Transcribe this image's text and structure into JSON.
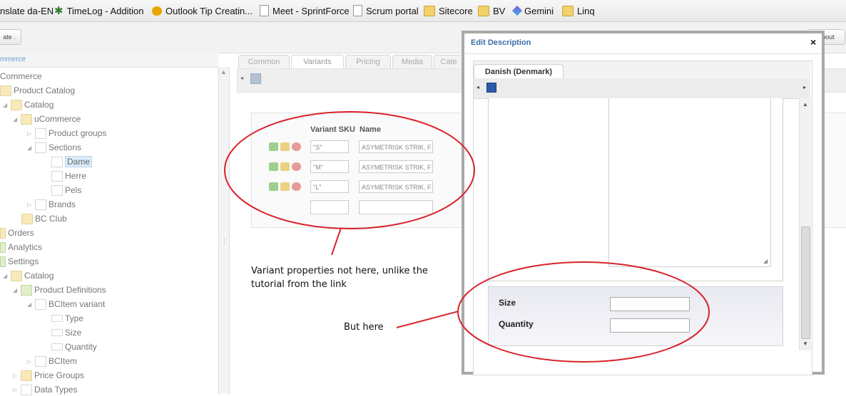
{
  "bookmarks": {
    "items": [
      {
        "label": "nslate da-EN",
        "icon": "none"
      },
      {
        "label": "TimeLog - Addition",
        "icon": "star-icon"
      },
      {
        "label": "Outlook Tip Creatin...",
        "icon": "outlook-icon"
      },
      {
        "label": "Meet - SprintForce",
        "icon": "page-icon"
      },
      {
        "label": "Scrum portal",
        "icon": "page-icon"
      },
      {
        "label": "Sitecore",
        "icon": "folder-icon"
      },
      {
        "label": "BV",
        "icon": "folder-icon"
      },
      {
        "label": "Gemini",
        "icon": "gemini-icon"
      },
      {
        "label": "Linq",
        "icon": "folder-icon"
      }
    ]
  },
  "toolbar": {
    "left_button": "ate .",
    "about_button": "About"
  },
  "tree": {
    "header": "mmerce",
    "nodes": [
      {
        "label": "Commerce"
      },
      {
        "label": "Product Catalog"
      },
      {
        "label": "Catalog"
      },
      {
        "label": "uCommerce"
      },
      {
        "label": "Product groups"
      },
      {
        "label": "Sections"
      },
      {
        "label": "Dame"
      },
      {
        "label": "Herre"
      },
      {
        "label": "Pels"
      },
      {
        "label": "Brands"
      },
      {
        "label": "BC Club"
      },
      {
        "label": "Orders"
      },
      {
        "label": "Analytics"
      },
      {
        "label": "Settings"
      },
      {
        "label": "Catalog"
      },
      {
        "label": "Product Definitions"
      },
      {
        "label": "BCItem variant"
      },
      {
        "label": "Type"
      },
      {
        "label": "Size"
      },
      {
        "label": "Quantity"
      },
      {
        "label": "BCItem"
      },
      {
        "label": "Price Groups"
      },
      {
        "label": "Data Types"
      }
    ]
  },
  "main": {
    "tabs": [
      {
        "label": "Common"
      },
      {
        "label": "Variants"
      },
      {
        "label": "Pricing"
      },
      {
        "label": "Media"
      },
      {
        "label": "Cate"
      }
    ],
    "variants": {
      "header_sku": "Variant SKU",
      "header_name": "Name",
      "rows": [
        {
          "sku": "\"S\"",
          "name": "ASYMETRISK STRIK, F"
        },
        {
          "sku": "\"M\"",
          "name": "ASYMETRISK STRIK, F"
        },
        {
          "sku": "\"L\"",
          "name": "ASYMETRISK STRIK, F"
        }
      ],
      "new_row": {
        "sku": "",
        "name": ""
      }
    }
  },
  "dialog": {
    "title": "Edit Description",
    "close": "×",
    "tab": "Danish (Denmark)",
    "fields": [
      {
        "label": "Size",
        "value": ""
      },
      {
        "label": "Quantity",
        "value": ""
      }
    ]
  },
  "annotations": {
    "note1_line1": "Variant properties not here, unlike the",
    "note1_line2": "tutorial from the link",
    "note2": "But here",
    "color": "#d9232a"
  },
  "colors": {
    "dialog_title": "#3a6fa6",
    "annotation_red": "#d9232a"
  }
}
